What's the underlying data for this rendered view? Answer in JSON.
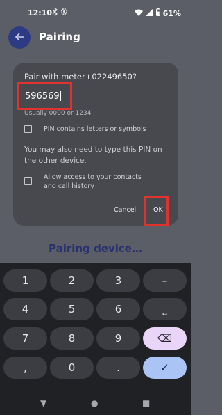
{
  "status_bar": {
    "time": "12:10",
    "battery": "61%",
    "icons": [
      "bluetooth-icon",
      "settings-icon",
      "wifi-icon",
      "signal-icon",
      "battery-icon"
    ]
  },
  "app_bar": {
    "title": "Pairing",
    "back_icon": "arrow-left-icon"
  },
  "dialog": {
    "title": "Pair with meter+02249650?",
    "pin_value": "596569",
    "hint": "Usually 0000 or 1234",
    "checkbox_letters_label": "PIN contains letters or symbols",
    "checkbox_letters_checked": false,
    "note": "You may also need to type this PIN on the other device.",
    "checkbox_contacts_label": "Allow access to your contacts and call history",
    "checkbox_contacts_checked": false,
    "cancel_label": "Cancel",
    "ok_label": "OK"
  },
  "background_text": "Pairing device…",
  "keyboard": {
    "keys": [
      {
        "label": "1"
      },
      {
        "label": "2"
      },
      {
        "label": "3"
      },
      {
        "label": "–"
      },
      {
        "label": "4"
      },
      {
        "label": "5"
      },
      {
        "label": "6"
      },
      {
        "label": "⎵"
      },
      {
        "label": "7"
      },
      {
        "label": "8"
      },
      {
        "label": "9"
      },
      {
        "label": "⌫"
      },
      {
        "label": ","
      },
      {
        "label": "0"
      },
      {
        "label": "."
      },
      {
        "label": "✓"
      }
    ]
  },
  "nav_bar": {
    "back": "▼",
    "home": "●",
    "recents": "■"
  },
  "colors": {
    "accent": "#2d3a84",
    "highlight": "#e0322f",
    "key_background": "#3c3d42",
    "backspace_key": "#e8d5f7",
    "enter_key": "#a9c4f5"
  }
}
